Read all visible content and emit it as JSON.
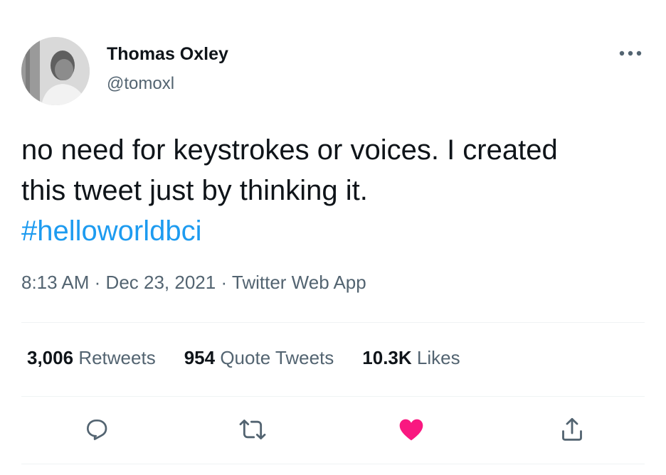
{
  "tweet": {
    "author_name": "Thomas Oxley",
    "author_handle": "@tomoxl",
    "text_line1": "no need for keystrokes or voices. I created",
    "text_line2": "this tweet just by thinking it.",
    "hashtag": "#helloworldbci",
    "time": "8:13 AM",
    "date": "Dec 23, 2021",
    "source": "Twitter Web App",
    "separator": "·"
  },
  "stats": [
    {
      "count": "3,006",
      "label": "Retweets"
    },
    {
      "count": "954",
      "label": "Quote Tweets"
    },
    {
      "count": "10.3K",
      "label": "Likes"
    }
  ],
  "actions": {
    "reply_icon": "reply-icon",
    "retweet_icon": "retweet-icon",
    "like_icon": "like-icon",
    "share_icon": "share-icon",
    "like_color": "#f91880",
    "icon_color": "#536471",
    "liked": true
  },
  "colors": {
    "accent": "#1d9bf0",
    "text": "#0f1419",
    "secondary": "#536471"
  }
}
